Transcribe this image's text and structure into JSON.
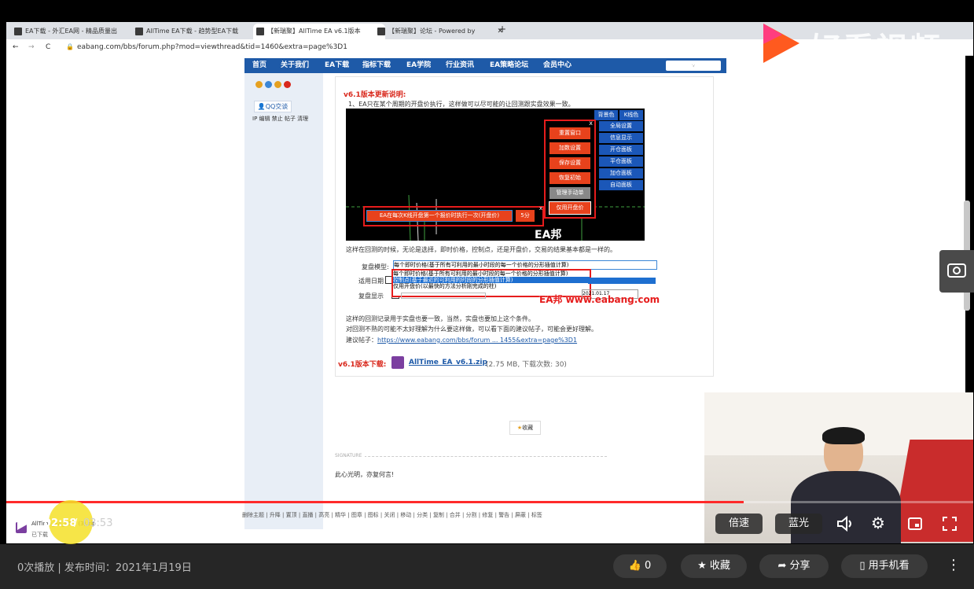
{
  "browser": {
    "tabs": [
      {
        "label": "EA下载 - 外汇EA网 - 精品质量出",
        "active": false
      },
      {
        "label": "AllTime EA下载 - 趋势型EA下载",
        "active": false
      },
      {
        "label": "【新瑞聚】AllTime EA v6.1版本",
        "active": true
      },
      {
        "label": "【新瑞聚】论坛 - Powered by",
        "active": false
      }
    ],
    "new_tab": "+",
    "url": "eabang.com/bbs/forum.php?mod=viewthread&tid=1460&extra=page%3D1"
  },
  "site_nav": {
    "items": [
      "首页",
      "关于我们",
      "EA下载",
      "指标下载",
      "EA学院",
      "行业资讯",
      "EA策略论坛",
      "会员中心"
    ],
    "quick_nav": "快捷导航"
  },
  "sidebar": {
    "qq": "QQ交谈",
    "actions": "IP 编辑 禁止 帖子 清理"
  },
  "post": {
    "update_title": "v6.1版本更新说明:",
    "update_line": "1、EA只在某个周期的开盘价执行，这样做可以尽可能的让回测跟实盘效果一致。",
    "chart_panel": {
      "top_tabs": [
        "背景色",
        "K线色"
      ],
      "right_menu": [
        "全局设置",
        "信息显示",
        "开仓面板",
        "平仓面板",
        "加仓面板",
        "自动面板"
      ],
      "popup_buttons": [
        "重置窗口",
        "加数设置",
        "保存设置",
        "恢复初始",
        "管理手动单"
      ],
      "open_price_button": "仅用开盘价",
      "bar_text": "EA在每次K线开盘第一个报价时执行一次(开盘价)",
      "bar_period": "5分",
      "close": "x",
      "watermark": "EA邦 www.eabang.com"
    },
    "para1": "这样在回测的时候，无论是选择，即时价格，控制点，还是开盘价，交易的结果基本都是一样的。",
    "tester": {
      "model_label": "复盘模型:",
      "options": [
        "每个即时价格(基于所有可利用的最小时段的每一个价格的分形插值计算)",
        "每个即时价格(基于所有可利用的最小时段的每一个价格的分形插值计算)",
        "控制点(基于最近的可利用的时段的分形插值计算)",
        "仅用开盘价(以最快的方法分析刚完成的柱)"
      ],
      "date_label": "适用日期",
      "visual_label": "复盘显示",
      "date_to": "2021.01.17",
      "watermark": "EA邦 www.eabang.com"
    },
    "para2": "这样的回测记录用于实盘也要一致，当然，实盘也要加上这个条件。",
    "para3": "对回测不熟的可能不太好理解为什么要这样做，可以看下面的建议帖子，可能会更好理解。",
    "suggest_label": "建议帖子：",
    "suggest_link": "https://www.eabang.com/bbs/forum ... 1455&extra=page%3D1",
    "download_title": "v6.1版本下载:",
    "file_name": "AllTime_EA_v6.1.zip",
    "file_meta": "(2.75 MB, 下载次数: 30)",
    "fav_button": "收藏",
    "signature_label": "SIGNATURE",
    "signature": "此心光明，亦复何言!",
    "footer_links": [
      "删除主题",
      "升降",
      "置顶",
      "直播",
      "高亮",
      "精华",
      "图章",
      "图标",
      "关闭",
      "移动",
      "分类",
      "复制",
      "合并",
      "分割",
      "修复",
      "警告",
      "屏蔽",
      "标签"
    ]
  },
  "download_bar": {
    "file": "AllTime_EA_v6.1 (3).zip",
    "status": "已下载"
  },
  "video": {
    "brand": "好看视频",
    "current_time": "02:58",
    "separator": "/",
    "total_time": "03:53",
    "progress": 0.763,
    "speed": "倍速",
    "quality": "蓝光"
  },
  "footer": {
    "info": "0次播放 | 发布时间：2021年1月19日",
    "like": "0",
    "favorite": "收藏",
    "share": "分享",
    "mobile": "用手机看"
  }
}
